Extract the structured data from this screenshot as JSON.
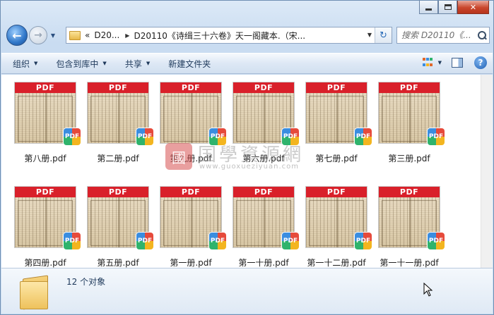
{
  "window": {
    "caption": {
      "minimize": "",
      "maximize": "",
      "close": "✕"
    }
  },
  "nav": {
    "back_glyph": "←",
    "forward_glyph": "→",
    "breadcrumb_prefix": "«",
    "breadcrumb": [
      "D20...",
      "D20110《诗缉三十六卷》天一阁藏本.（宋..."
    ],
    "refresh_glyph": "↻"
  },
  "search": {
    "placeholder": "搜索 D20110《..."
  },
  "toolbar": {
    "organize": "组织",
    "include_in_library": "包含到库中",
    "share": "共享",
    "new_folder": "新建文件夹",
    "help": "?"
  },
  "files": [
    {
      "name": "第八册.pdf"
    },
    {
      "name": "第二册.pdf"
    },
    {
      "name": "第九册.pdf"
    },
    {
      "name": "第六册.pdf"
    },
    {
      "name": "第七册.pdf"
    },
    {
      "name": "第三册.pdf"
    },
    {
      "name": "第四册.pdf"
    },
    {
      "name": "第五册.pdf"
    },
    {
      "name": "第一册.pdf"
    },
    {
      "name": "第一十册.pdf"
    },
    {
      "name": "第一十二册.pdf"
    },
    {
      "name": "第一十一册.pdf"
    }
  ],
  "thumb": {
    "band": "PDF",
    "badge": "PDF"
  },
  "watermark": {
    "seal": "國",
    "title": "国學資源網",
    "url": "www.guoxueziyuan.com"
  },
  "status": {
    "count": "12 个对象"
  },
  "colors": {
    "pdf_red": "#d9202a",
    "accent": "#1e395b"
  }
}
